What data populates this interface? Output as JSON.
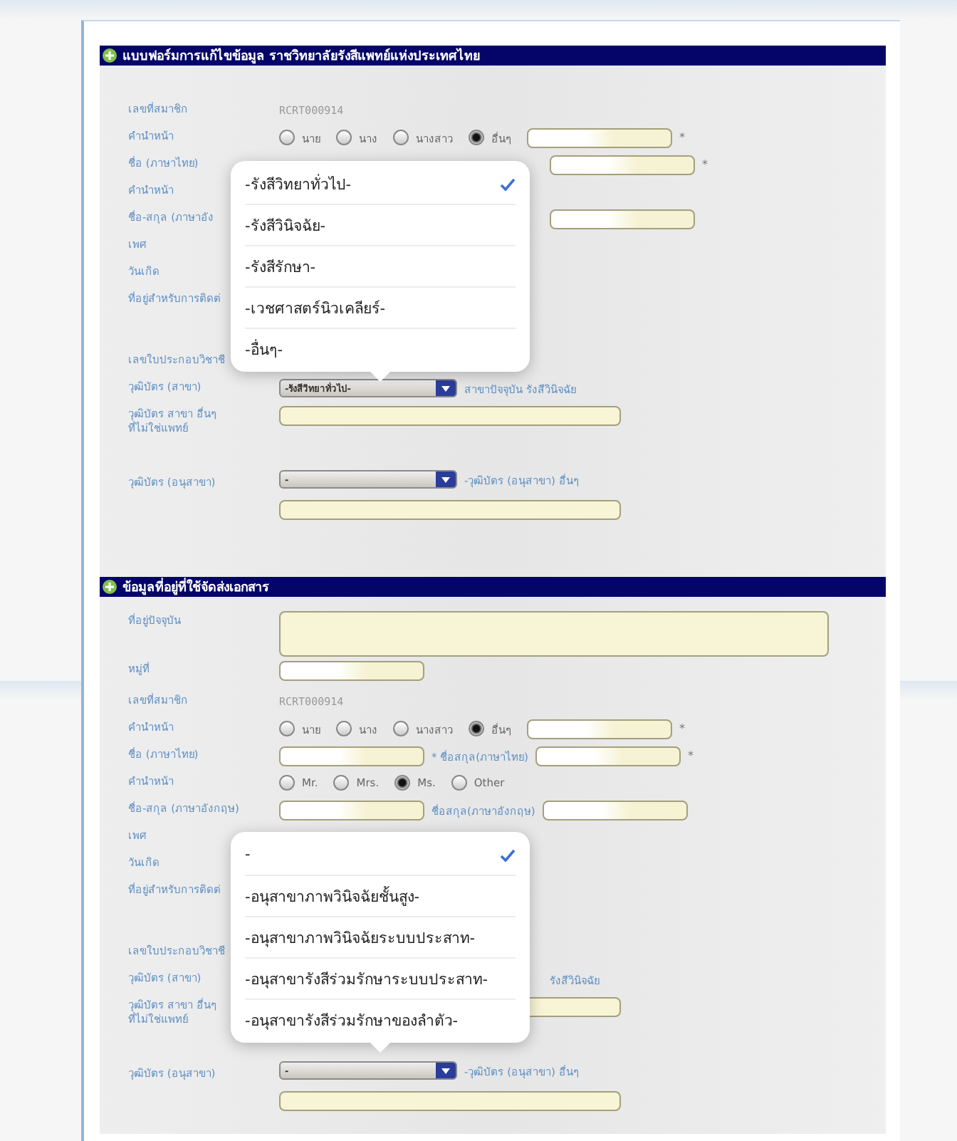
{
  "screens": [
    {
      "blocks": [
        {
          "kind": "header",
          "text": "แบบฟอร์มการแก้ไขข้อมูล ราชวิทยาลัยรังสีแพทย์แห่งประเทศไทย"
        },
        {
          "kind": "form",
          "rows": [
            {
              "kind": "row",
              "label": "เลขที่สมาชิก",
              "items": [
                {
                  "kind": "value",
                  "text": "RCRT000914"
                }
              ]
            },
            {
              "kind": "row",
              "label": "คำนำหน้า",
              "items": [
                {
                  "kind": "radio",
                  "text": "นาย",
                  "selected": false
                },
                {
                  "kind": "radio",
                  "text": "นาง",
                  "selected": false
                },
                {
                  "kind": "radio",
                  "text": "นางสาว",
                  "selected": false
                },
                {
                  "kind": "radio",
                  "text": "อื่นๆ",
                  "selected": true
                },
                {
                  "kind": "field"
                },
                {
                  "kind": "mark",
                  "text": "*"
                }
              ]
            },
            {
              "kind": "row",
              "label": "ชื่อ (ภาษาไทย)",
              "items": [
                {
                  "kind": "gap"
                },
                {
                  "kind": "field"
                },
                {
                  "kind": "mark",
                  "text": "*"
                }
              ]
            },
            {
              "kind": "row",
              "label": "คำนำหน้า",
              "items": []
            },
            {
              "kind": "row",
              "label": "ชื่อ-สกุล (ภาษาอัง",
              "items": [
                {
                  "kind": "gap"
                },
                {
                  "kind": "field"
                }
              ]
            },
            {
              "kind": "row",
              "label": "เพศ",
              "items": []
            },
            {
              "kind": "row",
              "label": "วันเกิด",
              "items": []
            },
            {
              "kind": "row",
              "label": "ที่อยู่สำหรับการติดต่",
              "items": []
            },
            {
              "kind": "spacer"
            },
            {
              "kind": "row",
              "label": "เลขใบประกอบวิชาชี",
              "items": []
            },
            {
              "kind": "row",
              "label": "วุฒิบัตร (สาขา)",
              "items": [
                {
                  "kind": "select",
                  "text": "-รังสีวิทยาทั่วไป-"
                },
                {
                  "kind": "note",
                  "text": "สาขาปัจจุบัน รังสีวินิจฉัย"
                }
              ]
            },
            {
              "kind": "row",
              "label": "วุฒิบัตร สาขา อื่นๆ\nที่ไม่ใช่แพทย์",
              "items": [
                {
                  "kind": "wide_field"
                }
              ]
            },
            {
              "kind": "spacer"
            },
            {
              "kind": "row",
              "label": "วุฒิบัตร (อนุสาขา)",
              "items": [
                {
                  "kind": "select",
                  "text": "-"
                },
                {
                  "kind": "note",
                  "text": "-วุฒิบัตร (อนุสาขา) อื่นๆ"
                },
                {
                  "kind": "break"
                },
                {
                  "kind": "wide_field"
                }
              ]
            },
            {
              "kind": "spacer"
            }
          ]
        },
        {
          "kind": "header",
          "text": "ข้อมูลที่อยู่ที่ใช้จัดส่งเอกสาร"
        },
        {
          "kind": "form",
          "rows": [
            {
              "kind": "row",
              "label": "ที่อยู่ปัจจุบัน",
              "items": [
                {
                  "kind": "textarea"
                }
              ]
            },
            {
              "kind": "row",
              "label": "หมู่ที่",
              "items": [
                {
                  "kind": "field"
                }
              ]
            }
          ]
        }
      ],
      "dropdown": {
        "options": [
          {
            "text": "-รังสีวิทยาทั่วไป-",
            "selected": true
          },
          {
            "text": "-รังสีวินิจฉัย-",
            "selected": false
          },
          {
            "text": "-รังสีรักษา-",
            "selected": false
          },
          {
            "text": "-เวชศาสตร์นิวเคลียร์-",
            "selected": false
          },
          {
            "text": "-อื่นๆ-",
            "selected": false
          }
        ]
      }
    },
    {
      "blocks": [
        {
          "kind": "form",
          "rows": [
            {
              "kind": "row",
              "label": "เลขที่สมาชิก",
              "items": [
                {
                  "kind": "value",
                  "text": "RCRT000914"
                }
              ]
            },
            {
              "kind": "row",
              "label": "คำนำหน้า",
              "items": [
                {
                  "kind": "radio",
                  "text": "นาย",
                  "selected": false
                },
                {
                  "kind": "radio",
                  "text": "นาง",
                  "selected": false
                },
                {
                  "kind": "radio",
                  "text": "นางสาว",
                  "selected": false
                },
                {
                  "kind": "radio",
                  "text": "อื่นๆ",
                  "selected": true
                },
                {
                  "kind": "field"
                },
                {
                  "kind": "mark",
                  "text": "*"
                }
              ]
            },
            {
              "kind": "row",
              "label": "ชื่อ (ภาษาไทย)",
              "items": [
                {
                  "kind": "field"
                },
                {
                  "kind": "note",
                  "text": "* ชื่อสกุล(ภาษาไทย)"
                },
                {
                  "kind": "field"
                },
                {
                  "kind": "mark",
                  "text": "*"
                }
              ]
            },
            {
              "kind": "row",
              "label": "คำนำหน้า",
              "items": [
                {
                  "kind": "radio",
                  "text": "Mr.",
                  "selected": false
                },
                {
                  "kind": "radio",
                  "text": "Mrs.",
                  "selected": false
                },
                {
                  "kind": "radio",
                  "text": "Ms.",
                  "selected": true
                },
                {
                  "kind": "radio",
                  "text": "Other",
                  "selected": false
                }
              ]
            },
            {
              "kind": "row",
              "label": "ชื่อ-สกุล (ภาษาอังกฤษ)",
              "items": [
                {
                  "kind": "field"
                },
                {
                  "kind": "note",
                  "text": "ชื่อสกุล(ภาษาอังกฤษ)"
                },
                {
                  "kind": "field"
                }
              ]
            },
            {
              "kind": "row",
              "label": "เพศ",
              "items": []
            },
            {
              "kind": "row",
              "label": "วันเกิด",
              "items": []
            },
            {
              "kind": "row",
              "label": "ที่อยู่สำหรับการติดต่",
              "items": []
            },
            {
              "kind": "spacer"
            },
            {
              "kind": "row",
              "label": "เลขใบประกอบวิชาชี",
              "items": []
            },
            {
              "kind": "row",
              "label": "วุฒิบัตร (สาขา)",
              "items": [
                {
                  "kind": "gap"
                },
                {
                  "kind": "note",
                  "text": "รังสีวินิจฉัย"
                }
              ]
            },
            {
              "kind": "row",
              "label": "วุฒิบัตร สาขา อื่นๆ\nที่ไม่ใช่แพทย์",
              "items": [
                {
                  "kind": "wide_field"
                }
              ]
            },
            {
              "kind": "spacer"
            },
            {
              "kind": "row",
              "label": "วุฒิบัตร (อนุสาขา)",
              "items": [
                {
                  "kind": "select",
                  "text": "-"
                },
                {
                  "kind": "note",
                  "text": "-วุฒิบัตร (อนุสาขา) อื่นๆ"
                },
                {
                  "kind": "break"
                },
                {
                  "kind": "wide_field"
                }
              ]
            }
          ]
        }
      ],
      "dropdown": {
        "options": [
          {
            "text": "-",
            "selected": true
          },
          {
            "text": "-อนุสาขาภาพวินิจฉัยชั้นสูง-",
            "selected": false
          },
          {
            "text": "-อนุสาขาภาพวินิจฉัยระบบประสาท-",
            "selected": false
          },
          {
            "text": "-อนุสาขารังสีร่วมรักษาระบบประสาท-",
            "selected": false
          },
          {
            "text": "-อนุสาขารังสีร่วมรักษาของลำตัว-",
            "selected": false
          }
        ]
      }
    }
  ]
}
